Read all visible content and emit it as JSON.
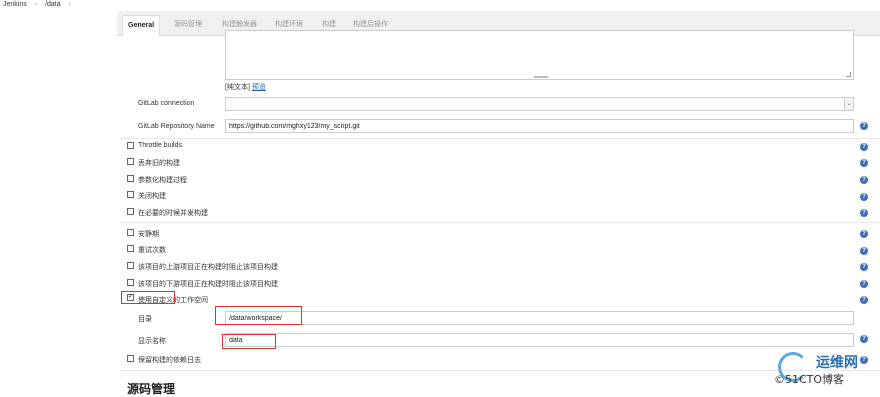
{
  "breadcrumb": {
    "items": [
      "Jenkins",
      "/data"
    ],
    "separator": "›"
  },
  "tabs": [
    {
      "label": "General",
      "active": true
    },
    {
      "label": "源码管理"
    },
    {
      "label": "构建触发器"
    },
    {
      "label": "构建环境"
    },
    {
      "label": "构建"
    },
    {
      "label": "构建后操作"
    }
  ],
  "description": {
    "plain_text": "[纯文本]",
    "preview": "预览"
  },
  "gitlab_connection": {
    "label": "GitLab connection",
    "value": ""
  },
  "gitlab_repo": {
    "label": "GitLab Repository Name",
    "value": "https://github.com/mghxy123/my_script.git"
  },
  "options_a": [
    {
      "label": "Throttle builds",
      "checked": false
    },
    {
      "label": "丢弃旧的构建",
      "checked": false
    },
    {
      "label": "参数化构建过程",
      "checked": false
    },
    {
      "label": "关闭构建",
      "checked": false
    },
    {
      "label": "在必要的时候并发构建",
      "checked": false
    }
  ],
  "options_b": [
    {
      "label": "安静期",
      "checked": false
    },
    {
      "label": "重试次数",
      "checked": false
    },
    {
      "label": "该项目的上游项目正在构建时阻止该项目构建",
      "checked": false
    },
    {
      "label": "该项目的下游项目正在构建时阻止该项目构建",
      "checked": false
    },
    {
      "label": "使用自定义的工作空间",
      "checked": true
    }
  ],
  "workspace": {
    "dir_label": "目录",
    "dir_value": "/data/workspace/",
    "name_label": "显示名称",
    "name_value": "data"
  },
  "keep_deps": {
    "label": "保留构建的依赖日志",
    "checked": false
  },
  "section_title": "源码管理",
  "help_icon": "?",
  "watermark": {
    "line1": "运维网",
    "line2": "©51CTO博客"
  }
}
